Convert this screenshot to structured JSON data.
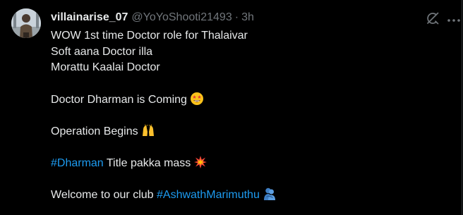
{
  "tweet": {
    "display_name": "villainarise_07",
    "handle": "@YoYoShooti21493",
    "separator": "·",
    "time": "3h",
    "lines": {
      "l1": "WOW 1st time Doctor role for Thalaivar",
      "l2": "Soft aana Doctor illa",
      "l3": "Morattu Kaalai Doctor",
      "l4": "Doctor Dharman is Coming",
      "l5": "Operation Begins",
      "l6_hashtag": "#Dharman",
      "l6_text": " Title pakka mass",
      "l7_text": "Welcome to our club ",
      "l7_hashtag": "#AshwathMarimuthu"
    },
    "emojis": [
      "star-struck-emoji",
      "raising-hands-emoji",
      "collision-emoji",
      "people-hugging-emoji"
    ]
  },
  "colors": {
    "background": "#000000",
    "text": "#e7e9ea",
    "muted": "#71767b",
    "link": "#1d9bf0"
  },
  "icons": [
    "grok-icon",
    "more-icon"
  ]
}
